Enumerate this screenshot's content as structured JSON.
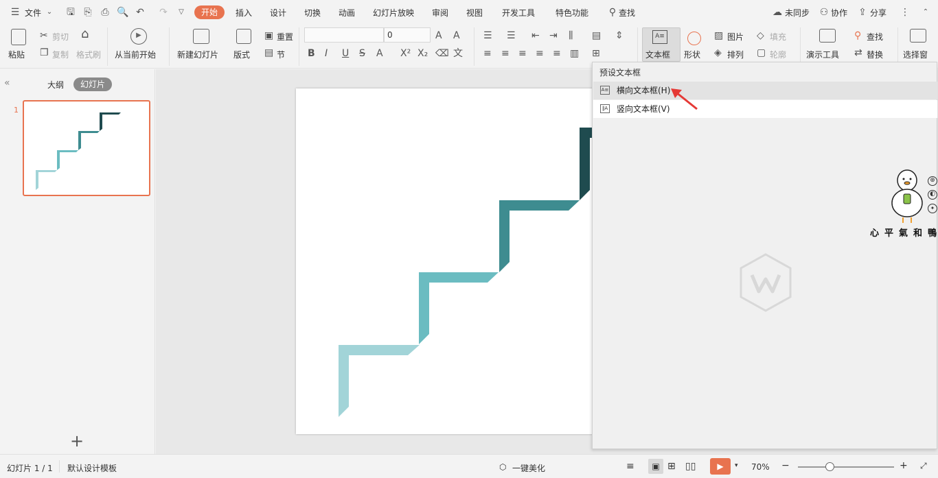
{
  "menubar": {
    "file_label": "文件",
    "tabs": [
      "开始",
      "插入",
      "设计",
      "切换",
      "动画",
      "幻灯片放映",
      "审阅",
      "视图",
      "开发工具",
      "特色功能"
    ],
    "active_tab": "开始",
    "search_label": "查找",
    "sync_label": "未同步",
    "collab_label": "协作",
    "share_label": "分享"
  },
  "ribbon": {
    "paste": "粘贴",
    "cut": "剪切",
    "copy": "复制",
    "format_painter": "格式刷",
    "from_current": "从当前开始",
    "new_slide": "新建幻灯片",
    "layout": "版式",
    "reset": "重置",
    "section": "节",
    "font_name": "",
    "font_size": "0",
    "textbox": "文本框",
    "shape": "形状",
    "picture": "图片",
    "arrange": "排列",
    "fill": "填充",
    "outline": "轮廓",
    "present_tools": "演示工具",
    "find": "查找",
    "replace": "替换",
    "select_pane": "选择窗"
  },
  "left_panel": {
    "tab_outline": "大纲",
    "tab_slides": "幻灯片",
    "slide_number": "1",
    "add_symbol": "+"
  },
  "dropdown": {
    "header": "预设文本框",
    "items": [
      "横向文本框(H)",
      "竖向文本框(V)"
    ]
  },
  "statusbar": {
    "slide_info": "幻灯片 1 / 1",
    "template": "默认设计模板",
    "beautify": "一键美化",
    "zoom": "70%"
  },
  "colors": {
    "accent": "#e8734f",
    "stair_1": "#a2d4d8",
    "stair_2": "#6bbcc1",
    "stair_3": "#3e8c90",
    "stair_4": "#1f4b4f"
  }
}
